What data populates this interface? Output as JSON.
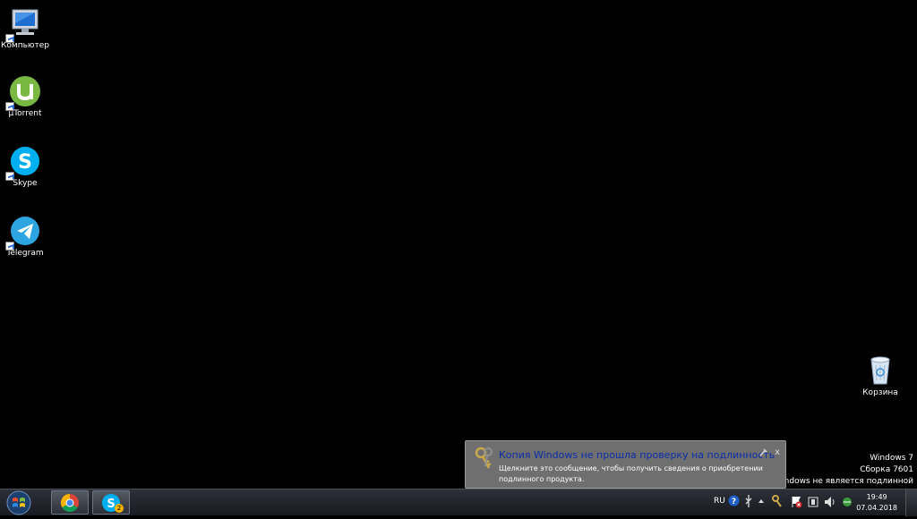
{
  "desktop": {
    "icons": [
      {
        "label": "Компьютер",
        "icon": "computer-icon"
      },
      {
        "label": "µTorrent",
        "icon": "utorrent-icon"
      },
      {
        "label": "Skype",
        "icon": "skype-icon"
      },
      {
        "label": "Telegram",
        "icon": "telegram-icon"
      },
      {
        "label": "Корзина",
        "icon": "recycle-bin-icon"
      }
    ],
    "watermark": {
      "line1": "Windows 7",
      "line2": "Сборка 7601",
      "line3": "Ваша копия Windows не является подлинной"
    }
  },
  "balloon": {
    "title": "Копия Windows не прошла проверку на подлинность",
    "text": "Щелкните это сообщение, чтобы получить сведения о приобретении подлинного продукта.",
    "close_label": "x"
  },
  "taskbar": {
    "pinned": [
      {
        "name": "Google Chrome",
        "icon": "chrome-icon"
      },
      {
        "name": "Skype",
        "icon": "skype-icon",
        "badge": "2"
      }
    ],
    "tray": {
      "language": "RU",
      "time": "19:49",
      "date": "07.04.2018"
    }
  },
  "colors": {
    "desktop_bg": "#000000",
    "balloon_bg": "#6f6f6f",
    "balloon_title": "#0b2ea8",
    "utorrent": "#78b843",
    "skype": "#00aff0",
    "telegram": "#2ca5e0"
  }
}
